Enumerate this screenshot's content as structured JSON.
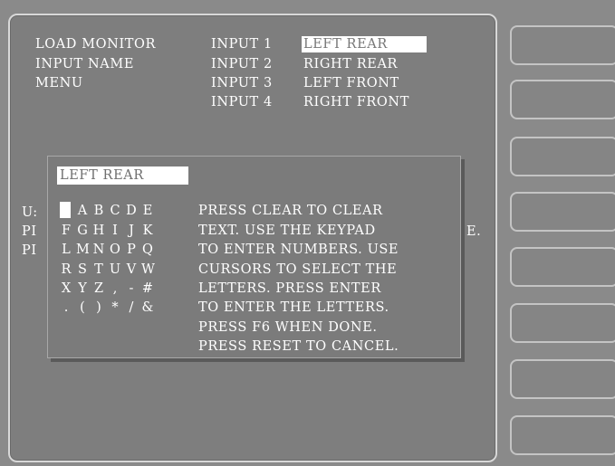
{
  "menu": {
    "lines": [
      "LOAD MONITOR",
      "INPUT NAME",
      "MENU"
    ]
  },
  "inputs": [
    {
      "label": "INPUT 1",
      "name": "LEFT REAR",
      "selected": true
    },
    {
      "label": "INPUT 2",
      "name": "RIGHT REAR",
      "selected": false
    },
    {
      "label": "INPUT 3",
      "name": "LEFT FRONT",
      "selected": false
    },
    {
      "label": "INPUT 4",
      "name": "RIGHT FRONT",
      "selected": false
    }
  ],
  "background_fragments": {
    "row1": "U:",
    "row2": "PI",
    "row3": "PI",
    "row2_right": "E."
  },
  "dialog": {
    "text_value": "LEFT REAR",
    "keyboard": [
      [
        "A",
        "B",
        "C",
        "D",
        "E"
      ],
      [
        "F",
        "G",
        "H",
        "I",
        "J",
        "K"
      ],
      [
        "L",
        "M",
        "N",
        "O",
        "P",
        "Q"
      ],
      [
        "R",
        "S",
        "T",
        "U",
        "V",
        "W"
      ],
      [
        "X",
        "Y",
        "Z",
        ",",
        "-",
        "#"
      ],
      [
        ".",
        "(",
        ")",
        "*",
        "/",
        "&"
      ]
    ],
    "instructions": [
      "PRESS CLEAR TO CLEAR",
      "TEXT. USE THE KEYPAD",
      "TO ENTER NUMBERS. USE",
      "CURSORS TO SELECT THE",
      "LETTERS. PRESS ENTER",
      "TO ENTER THE LETTERS.",
      "PRESS F6 WHEN DONE.",
      "PRESS RESET TO CANCEL."
    ]
  },
  "softkeys": [
    "",
    "",
    "",
    "",
    "",
    "",
    "",
    ""
  ]
}
